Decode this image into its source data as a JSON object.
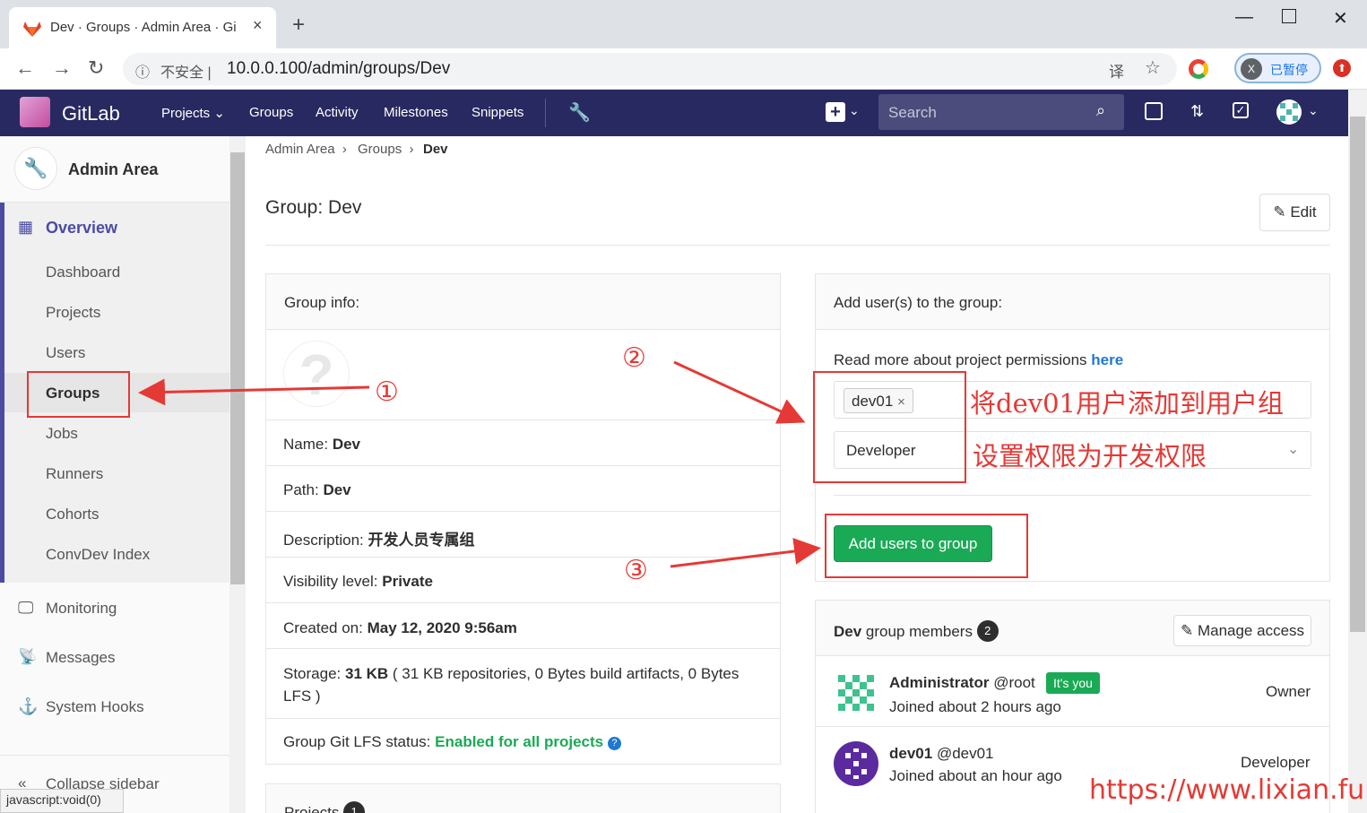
{
  "browser": {
    "tab_title": "Dev · Groups · Admin Area · Gi",
    "tab_close": "×",
    "new_tab": "+",
    "insecure_label": "不安全",
    "address": "10.0.0.100/admin/groups/Dev",
    "profile_initial": "X",
    "profile_label": "已暂停",
    "status_text": "javascript:void(0)"
  },
  "gitlab_header": {
    "brand": "GitLab",
    "nav": [
      "Projects",
      "Groups",
      "Activity",
      "Milestones",
      "Snippets"
    ],
    "search_placeholder": "Search"
  },
  "sidebar": {
    "title": "Admin Area",
    "section": "Overview",
    "items": [
      "Dashboard",
      "Projects",
      "Users",
      "Groups",
      "Jobs",
      "Runners",
      "Cohorts",
      "ConvDev Index"
    ],
    "lower": [
      "Monitoring",
      "Messages",
      "System Hooks"
    ],
    "collapse": "Collapse sidebar"
  },
  "breadcrumb": [
    "Admin Area",
    "Groups",
    "Dev"
  ],
  "page": {
    "title": "Group: Dev",
    "edit_label": "Edit"
  },
  "group_info": {
    "heading": "Group info:",
    "name_label": "Name:",
    "name": "Dev",
    "path_label": "Path:",
    "path": "Dev",
    "desc_label": "Description:",
    "desc": "开发人员专属组",
    "vis_label": "Visibility level:",
    "vis": "Private",
    "created_label": "Created on:",
    "created": "May 12, 2020 9:56am",
    "storage_label": "Storage:",
    "storage_value": "31 KB",
    "storage_detail_1": "( 31 KB repositories, 0 Bytes build artifacts, 0 Bytes",
    "storage_detail_2": "LFS )",
    "lfs_label": "Group Git LFS status:",
    "lfs_value": "Enabled for all projects",
    "projects_heading": "Projects",
    "projects_count": "1"
  },
  "add_users": {
    "heading": "Add user(s) to the group:",
    "read_more": "Read more about project permissions",
    "read_more_link": "here",
    "token": "dev01",
    "token_remove": "×",
    "role": "Developer",
    "submit": "Add users to group"
  },
  "members": {
    "group": "Dev",
    "title_rest": "group members",
    "count": "2",
    "manage": "Manage access",
    "list": [
      {
        "name": "Administrator",
        "handle": "@root",
        "badge": "It's you",
        "joined": "Joined about 2 hours ago",
        "role": "Owner"
      },
      {
        "name": "dev01",
        "handle": "@dev01",
        "badge": "",
        "joined": "Joined about an hour ago",
        "role": "Developer"
      }
    ]
  },
  "annotations": {
    "n1": "①",
    "n2": "②",
    "n3": "③",
    "note1": "将dev01用户添加到用户组",
    "note2": "设置权限为开发权限",
    "watermark": "https://www.lixian.fun"
  },
  "colors": {
    "header": "#292961",
    "accent_green": "#1aaa55",
    "annotation_red": "#e53935",
    "sidebar_active": "#4b4ba3"
  }
}
